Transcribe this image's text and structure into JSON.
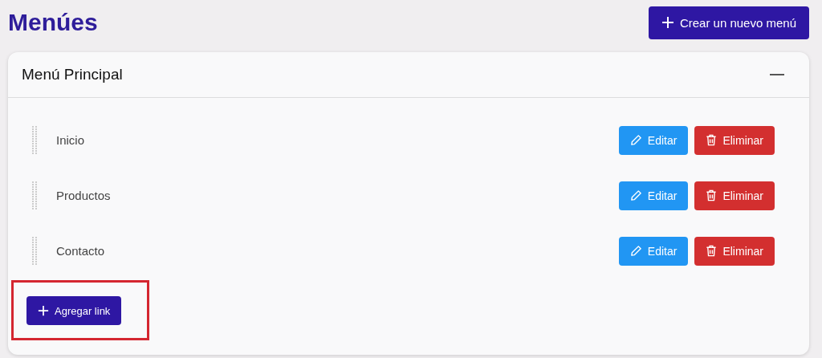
{
  "page_title": "Menúes",
  "create_button": {
    "label": "Crear un nuevo menú"
  },
  "menu_card": {
    "title": "Menú Principal",
    "expanded": true,
    "items": [
      {
        "label": "Inicio",
        "edit_label": "Editar",
        "delete_label": "Eliminar"
      },
      {
        "label": "Productos",
        "edit_label": "Editar",
        "delete_label": "Eliminar"
      },
      {
        "label": "Contacto",
        "edit_label": "Editar",
        "delete_label": "Eliminar"
      }
    ],
    "add_button": {
      "label": "Agregar link",
      "highlighted": true
    }
  }
}
